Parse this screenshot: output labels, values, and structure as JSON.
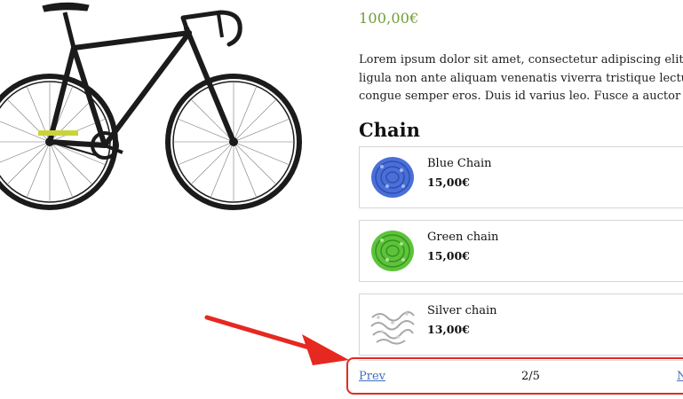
{
  "product": {
    "price": "100,00€",
    "description_lines": [
      "Lorem ipsum dolor sit amet, consectetur adipiscing elit. Sed",
      "ligula non ante aliquam venenatis viverra tristique lectus. N",
      "congue semper eros. Duis id varius leo. Fusce a auctor nulla."
    ]
  },
  "section": {
    "title": "Chain"
  },
  "options": [
    {
      "name": "Blue Chain",
      "price": "15,00€",
      "icon": "blue-chain-icon",
      "color": "#4a6fd8"
    },
    {
      "name": "Green chain",
      "price": "15,00€",
      "icon": "green-chain-icon",
      "color": "#5cc43a"
    },
    {
      "name": "Silver chain",
      "price": "13,00€",
      "icon": "silver-chain-icon",
      "color": "#b8b8b8"
    }
  ],
  "pagination": {
    "prev_label": "Prev",
    "page_indicator": "2/5",
    "next_label": "N"
  },
  "colors": {
    "price": "#6f9d35",
    "link": "#3f6fc2",
    "highlight": "#e52920"
  }
}
